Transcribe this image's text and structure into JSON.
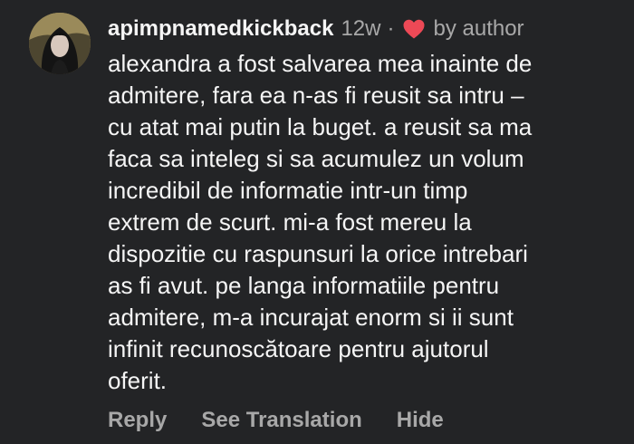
{
  "comment": {
    "username": "apimpnamedkickback",
    "time": "12w",
    "separator": "·",
    "liked_by": "by author",
    "body_lines": [
      "alexandra a fost salvarea mea inainte de",
      "admitere, fara ea n-as fi reusit sa intru –",
      "cu atat mai putin la buget. a reusit sa ma",
      "faca sa inteleg si sa acumulez un volum",
      "incredibil de informatie intr-un timp",
      "extrem de scurt. mi-a fost mereu la",
      "dispozitie cu raspunsuri la orice intrebari",
      "as fi avut. pe langa informatiile pentru",
      "admitere, m-a incurajat enorm si ii sunt",
      "infinit recunoscătoare pentru ajutorul",
      "oferit."
    ],
    "actions": {
      "reply": "Reply",
      "see_translation": "See Translation",
      "hide": "Hide"
    }
  },
  "colors": {
    "background": "#232426",
    "text": "#f5f5f5",
    "muted": "#a8a8a8",
    "heart": "#ed4956"
  },
  "icons": {
    "avatar": "profile-photo",
    "like": "heart-icon"
  }
}
